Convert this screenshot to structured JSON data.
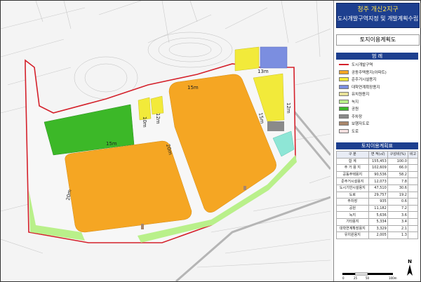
{
  "title": {
    "prefix": "청주",
    "name": "개신2지구",
    "subtitle": "도시개발구역지정 및 개발계획수립"
  },
  "map_title": "토지이용계획도",
  "legend": {
    "heading": "범    례",
    "items": [
      {
        "label": "도시개발구역",
        "color": "#d4202a",
        "kind": "line"
      },
      {
        "label": "공동주택용지(아파트)",
        "color": "#f5a623",
        "kind": "fill"
      },
      {
        "label": "준주거시설용지",
        "color": "#f2ea3a",
        "kind": "fill"
      },
      {
        "label": "대학연계확장용지",
        "color": "#7b8ee0",
        "kind": "fill"
      },
      {
        "label": "유치원용지",
        "color": "#e9e29a",
        "kind": "fill"
      },
      {
        "label": "녹지",
        "color": "#b9f08a",
        "kind": "fill"
      },
      {
        "label": "공원",
        "color": "#3cb828",
        "kind": "fill"
      },
      {
        "label": "주차장",
        "color": "#8a8a8a",
        "kind": "fill"
      },
      {
        "label": "보행자도로",
        "color": "#a9866a",
        "kind": "fill"
      },
      {
        "label": "도로",
        "color": "#f4e0e0",
        "kind": "fill"
      }
    ]
  },
  "table": {
    "heading": "토지이용계획표",
    "headers": [
      "구 분",
      "면 적(㎡)",
      "구성비(%)",
      "비고"
    ],
    "rows": [
      [
        "합 계",
        "155,453",
        "100.0",
        ""
      ],
      [
        "주 거 용 지",
        "102,609",
        "66.0",
        ""
      ],
      [
        "공동주택용지",
        "90,536",
        "58.2",
        ""
      ],
      [
        "준주거시설용지",
        "12,073",
        "7.8",
        ""
      ],
      [
        "도시기반시설용지",
        "47,510",
        "30.6",
        ""
      ],
      [
        "도로",
        "29,757",
        "19.2",
        ""
      ],
      [
        "주차장",
        "935",
        "0.6",
        ""
      ],
      [
        "공원",
        "11,182",
        "7.2",
        ""
      ],
      [
        "녹지",
        "5,636",
        "3.6",
        ""
      ],
      [
        "기타용지",
        "5,334",
        "3.4",
        ""
      ],
      [
        "대학연계확장용지",
        "3,329",
        "2.1",
        ""
      ],
      [
        "유치원용지",
        "2,005",
        "1.3",
        ""
      ]
    ]
  },
  "road_labels": [
    "15m",
    "15m",
    "10m",
    "12m",
    "20m",
    "15m",
    "12m",
    "13m",
    "20m"
  ],
  "scale": {
    "ticks": [
      "0",
      "25",
      "50",
      "100m"
    ]
  },
  "north_label": "N",
  "colors": {
    "residential": "#f5a623",
    "park": "#3cb828",
    "boundary": "#d4202a",
    "greenbelt": "#b9f08a",
    "commercial": "#f2ea3a",
    "university": "#7b8ee0",
    "parking": "#8a8a8a",
    "kindergarten": "#8ee6d6"
  }
}
